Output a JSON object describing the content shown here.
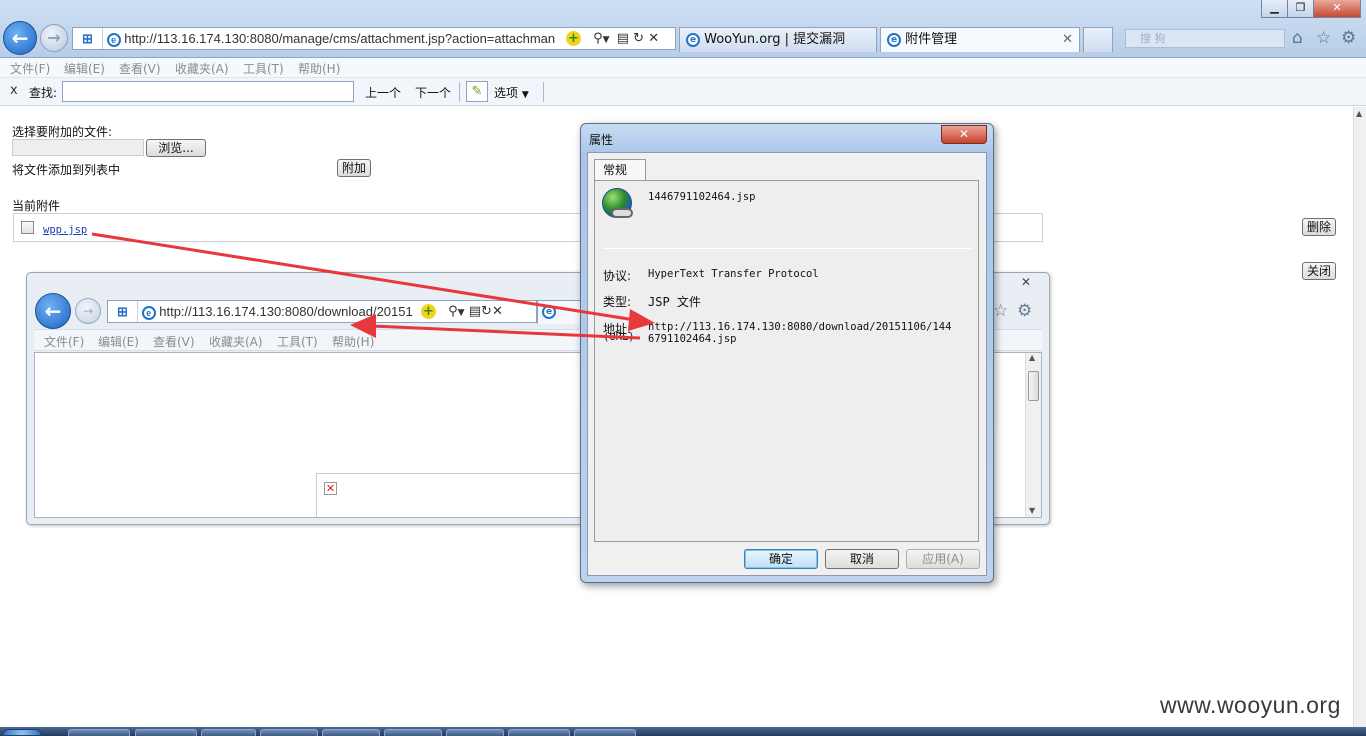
{
  "browser": {
    "address": "http://113.16.174.130:8080/manage/cms/attachment.jsp?action=attachman",
    "tabs": [
      {
        "label": "WooYun.org | 提交漏洞"
      },
      {
        "label": "附件管理"
      }
    ],
    "search_placeholder": "搜 狗"
  },
  "menu": [
    "文件(F)",
    "编辑(E)",
    "查看(V)",
    "收藏夹(A)",
    "工具(T)",
    "帮助(H)"
  ],
  "findbar": {
    "close": "x",
    "label": "查找:",
    "prev": "上一个",
    "next": "下一个",
    "options": "选项"
  },
  "page": {
    "choose_file_label": "选择要附加的文件:",
    "browse_button": "浏览...",
    "add_to_list_label": "将文件添加到列表中",
    "attach_button": "附加",
    "current_attachments_label": "当前附件",
    "attachment_link": "wpp.jsp",
    "delete_button": "删除",
    "close_button": "关闭"
  },
  "inner_browser": {
    "address": "http://113.16.174.130:8080/download/20151",
    "menu": [
      "文件(F)",
      "编辑(E)",
      "查看(V)",
      "收藏夹(A)",
      "工具(T)",
      "帮助(H)"
    ]
  },
  "dialog": {
    "title": "属性",
    "tab": "常规",
    "filename": "1446791102464.jsp",
    "protocol_label": "协议:",
    "protocol_value": "HyperText Transfer Protocol",
    "type_label": "类型:",
    "type_value": "JSP 文件",
    "address_label": "地址:",
    "address_label2": "(URL)",
    "address_line1": "http://113.16.174.130:8080/download/20151106/144",
    "address_line2": "6791102464.jsp",
    "ok": "确定",
    "cancel": "取消",
    "apply": "应用(A)"
  },
  "watermark": "www.wooyun.org",
  "colors": {
    "arrow": "#e8383b",
    "link": "#1a3fb5",
    "accent": "#2a6fc9"
  }
}
